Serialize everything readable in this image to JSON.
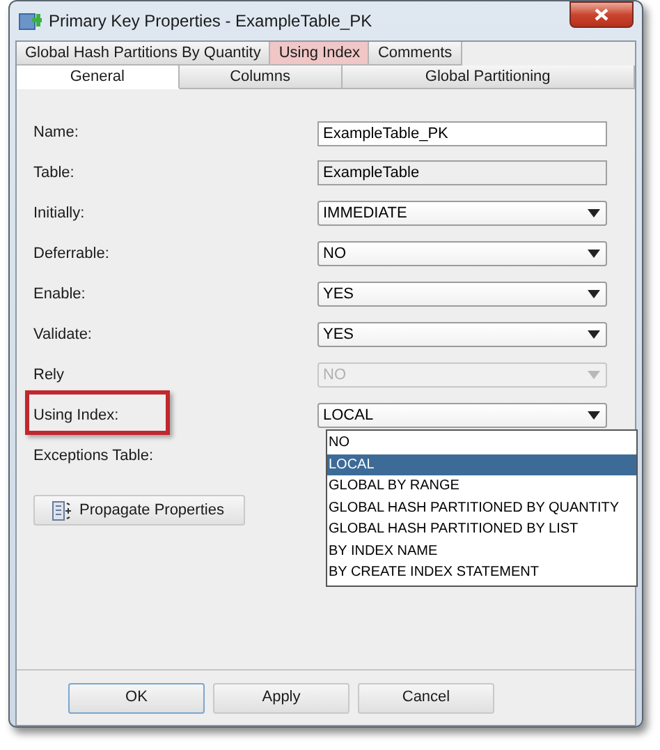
{
  "window": {
    "title": "Primary Key Properties - ExampleTable_PK"
  },
  "tab_rows": [
    [
      {
        "label": "Global Hash Partitions By Quantity",
        "selected": false
      },
      {
        "label": "Using Index",
        "selected": false,
        "highlighted": true
      },
      {
        "label": "Comments",
        "selected": false
      }
    ],
    [
      {
        "label": "General",
        "selected": true
      },
      {
        "label": "Columns",
        "selected": false
      },
      {
        "label": "Global Partitioning",
        "selected": false
      }
    ]
  ],
  "fields": [
    {
      "label": "Name:",
      "kind": "text",
      "value": "ExampleTable_PK"
    },
    {
      "label": "Table:",
      "kind": "readonly",
      "value": "ExampleTable"
    },
    {
      "label": "Initially:",
      "kind": "combo",
      "value": "IMMEDIATE",
      "disabled": false
    },
    {
      "label": "Deferrable:",
      "kind": "combo",
      "value": "NO",
      "disabled": false
    },
    {
      "label": "Enable:",
      "kind": "combo",
      "value": "YES",
      "disabled": false
    },
    {
      "label": "Validate:",
      "kind": "combo",
      "value": "YES",
      "disabled": false
    },
    {
      "label": "Rely",
      "kind": "combo",
      "value": "NO",
      "disabled": true
    },
    {
      "label": "Using Index:",
      "kind": "combo",
      "value": "LOCAL",
      "disabled": false,
      "highlighted": true,
      "options": [
        {
          "label": "NO",
          "selected": false
        },
        {
          "label": "LOCAL",
          "selected": true
        },
        {
          "label": "GLOBAL BY RANGE",
          "selected": false
        },
        {
          "label": "GLOBAL HASH PARTITIONED BY QUANTITY",
          "selected": false
        },
        {
          "label": "GLOBAL HASH PARTITIONED BY LIST",
          "selected": false
        },
        {
          "label": "BY INDEX NAME",
          "selected": false
        },
        {
          "label": "BY CREATE INDEX STATEMENT",
          "selected": false
        }
      ]
    },
    {
      "label": "Exceptions Table:",
      "kind": "none"
    }
  ],
  "propagate_button": "Propagate Properties",
  "buttons": [
    "OK",
    "Apply",
    "Cancel"
  ]
}
